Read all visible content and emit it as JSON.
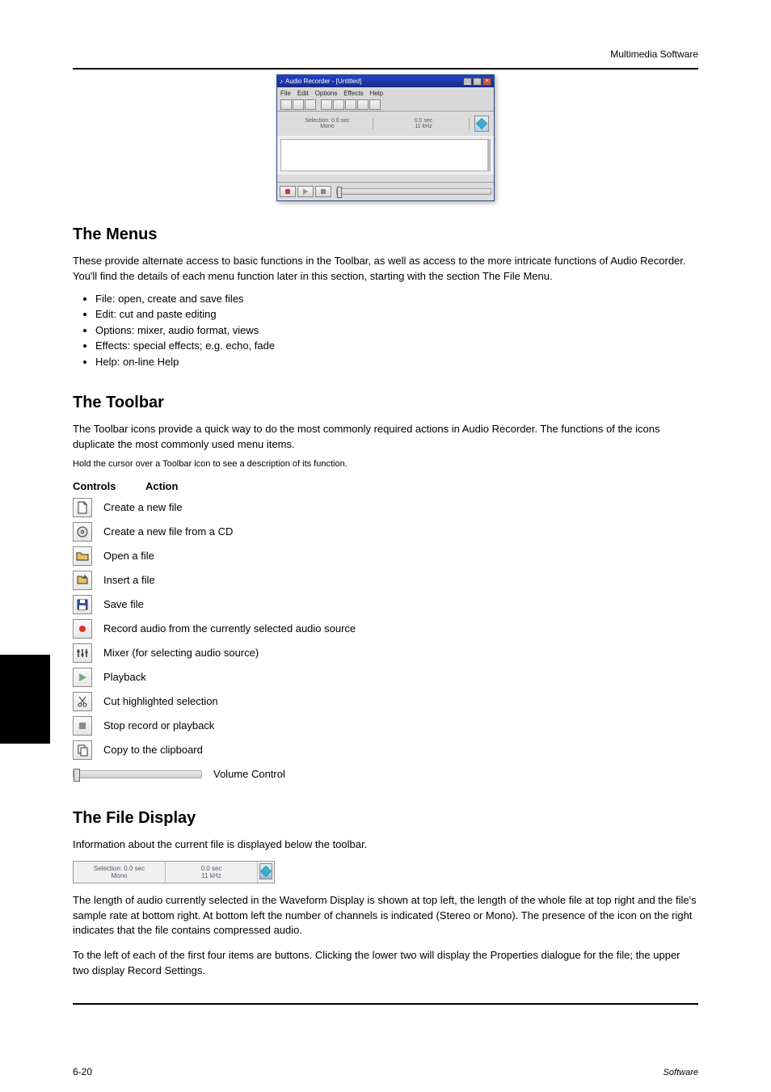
{
  "header": {
    "right": "Multimedia Software"
  },
  "screenshot": {
    "title": "Audio Recorder - [Untitled]",
    "menus": [
      "File",
      "Edit",
      "Options",
      "Effects",
      "Help"
    ],
    "info": {
      "sel_label": "Selection: 0.0 sec",
      "mode": "Mono",
      "dur": "0.0 sec",
      "rate": "11 kHz"
    }
  },
  "menu_section": {
    "title": "The Menus",
    "intro": "These provide alternate access to basic functions in the Toolbar, as well as access to the more intricate functions of Audio Recorder. You'll find the details of each menu function later in this section, starting with the section The File Menu.",
    "items": [
      "File: open, create and save files",
      "Edit: cut and paste editing",
      "Options: mixer, audio format, views",
      "Effects: special effects; e.g. echo, fade",
      "Help: on-line Help"
    ]
  },
  "toolbar_section": {
    "title": "The Toolbar",
    "intro": "The Toolbar icons provide a quick way to do the most commonly required actions in Audio Recorder. The functions of the icons duplicate the most commonly used menu items.",
    "tip": "Hold the cursor over a Toolbar icon to see a description of its function.",
    "col_controls": "Controls",
    "col_action": "Action",
    "rows": [
      {
        "icon": "new",
        "action": "Create a new file"
      },
      {
        "icon": "new-from-cd",
        "action": "Create a new file from a CD"
      },
      {
        "icon": "open",
        "action": "Open a file"
      },
      {
        "icon": "insert",
        "action": "Insert a file"
      },
      {
        "icon": "save",
        "action": "Save file"
      },
      {
        "icon": "record",
        "action": "Record audio from the currently selected audio source"
      },
      {
        "icon": "mixer",
        "action": "Mixer (for selecting audio source)"
      },
      {
        "icon": "play",
        "action": "Playback"
      },
      {
        "icon": "cut",
        "action": "Cut highlighted selection"
      },
      {
        "icon": "stop",
        "action": "Stop record or playback"
      },
      {
        "icon": "copy",
        "action": "Copy to the clipboard"
      },
      {
        "icon": "volume",
        "action": "Volume Control"
      }
    ]
  },
  "filedisplay_section": {
    "title": "The File Display",
    "p1": "Information about the current file is displayed below the toolbar.",
    "sel": "Selection: 0.0 sec",
    "mode": "Mono",
    "dur": "0.0 sec",
    "rate": "11 kHz",
    "p2": "The length of audio currently selected in the Waveform Display is shown at top left, the length of the whole file at top right and the file's sample rate at bottom right. At bottom left the number of channels is indicated (Stereo or Mono). The presence of the icon on the right indicates that the file contains compressed audio.",
    "p3": "To the left of each of the first four items are buttons. Clicking the lower two will display the Properties dialogue for the file; the upper two display Record Settings."
  },
  "footer": {
    "page": "6-20",
    "right": "Software"
  }
}
